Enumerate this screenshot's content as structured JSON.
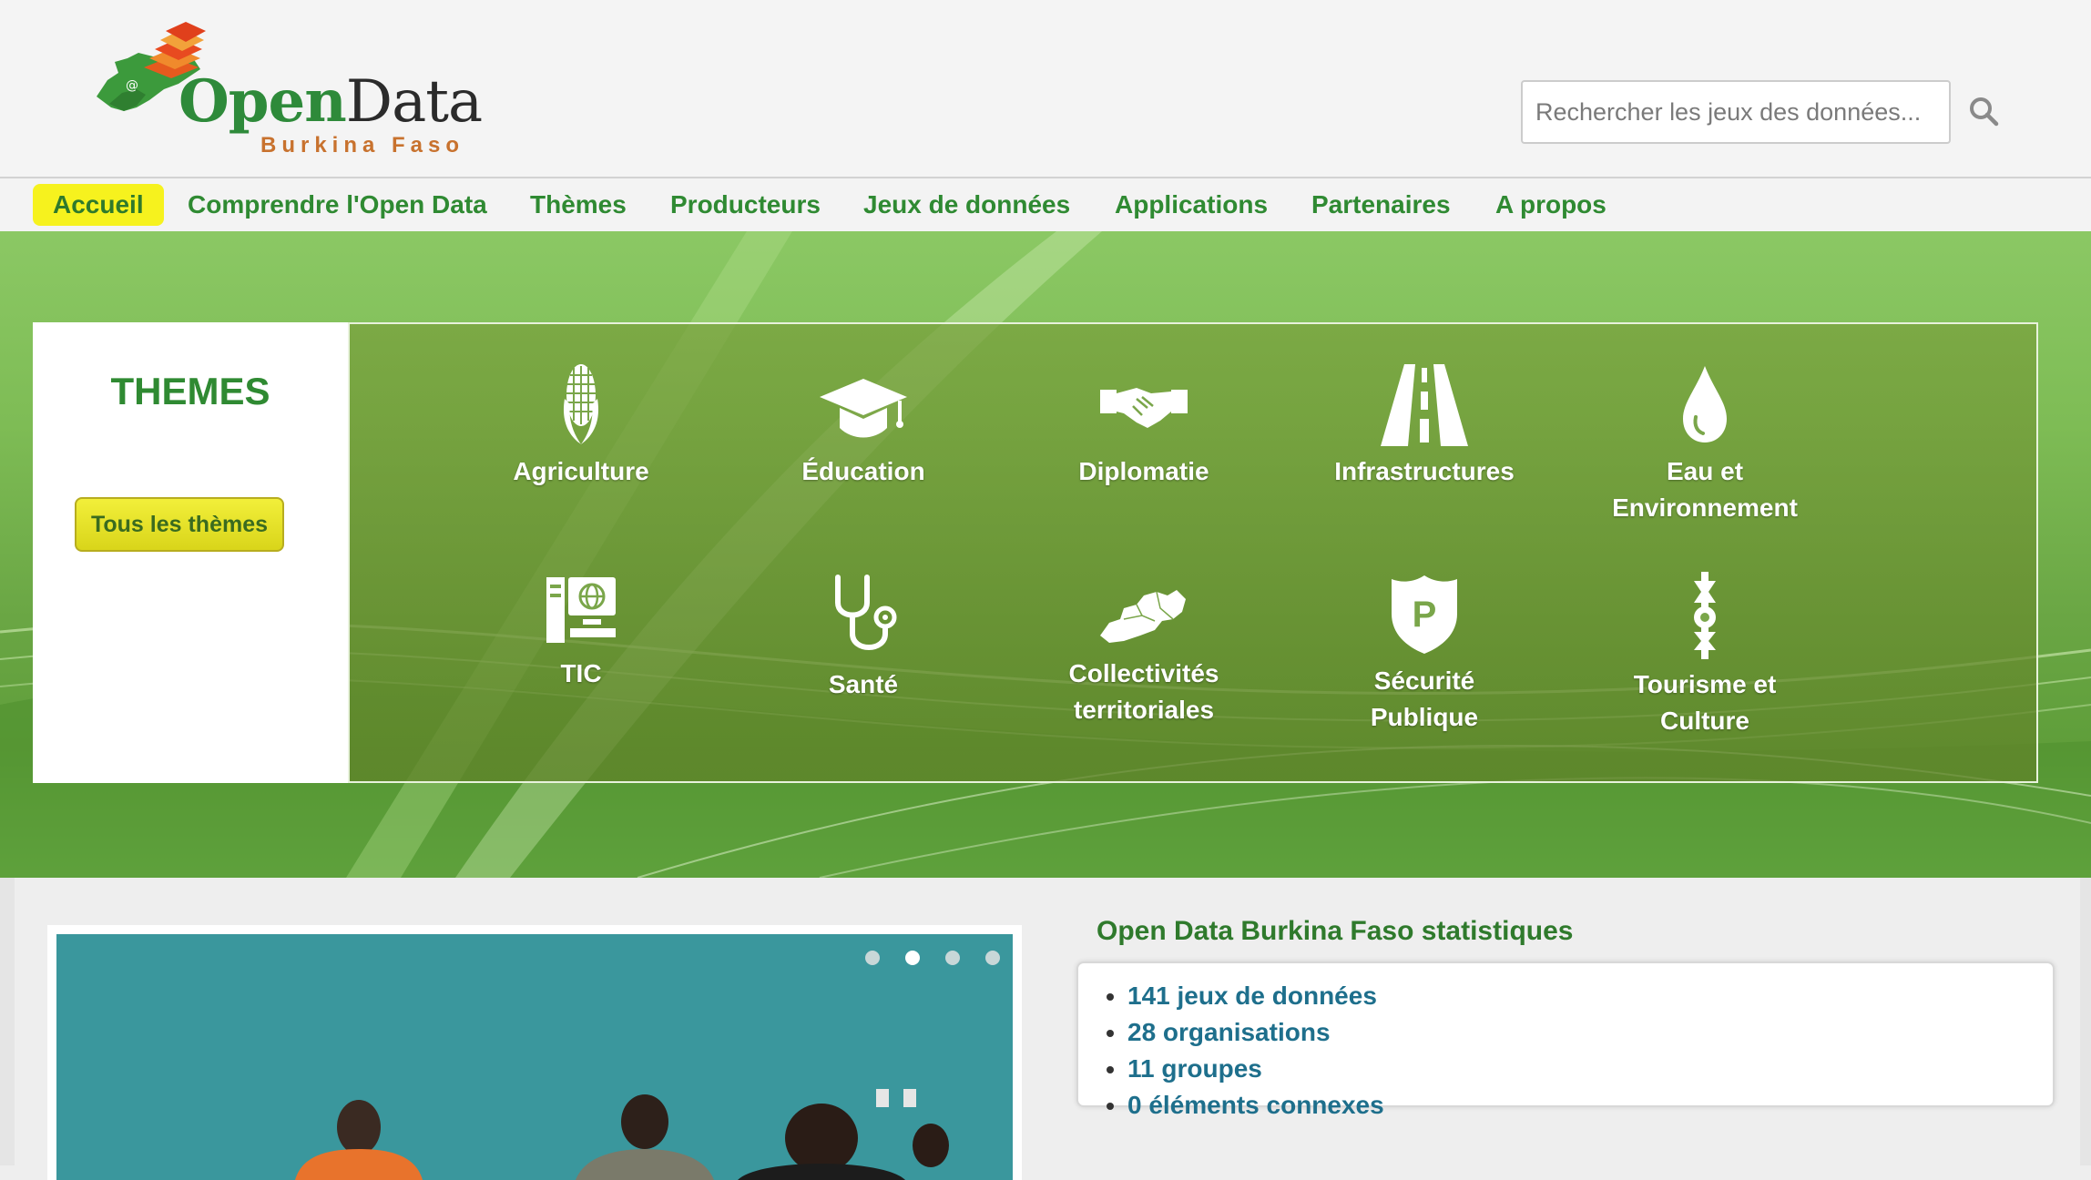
{
  "brand": {
    "name_part1": "Open",
    "name_part2": "Data",
    "subtitle": "Burkina Faso"
  },
  "search": {
    "placeholder": "Rechercher les jeux des données..."
  },
  "nav": {
    "items": [
      {
        "label": "Accueil",
        "active": true
      },
      {
        "label": "Comprendre l'Open Data"
      },
      {
        "label": "Thèmes"
      },
      {
        "label": "Producteurs"
      },
      {
        "label": "Jeux de données"
      },
      {
        "label": "Applications"
      },
      {
        "label": "Partenaires"
      },
      {
        "label": "A propos"
      }
    ]
  },
  "themes": {
    "title": "THEMES",
    "all_button": "Tous les thèmes",
    "items": [
      {
        "line1": "Agriculture",
        "line2": "",
        "icon": "corn-icon"
      },
      {
        "line1": "Éducation",
        "line2": "",
        "icon": "graduation-cap-icon"
      },
      {
        "line1": "Diplomatie",
        "line2": "",
        "icon": "handshake-icon"
      },
      {
        "line1": "Infrastructures",
        "line2": "",
        "icon": "road-icon"
      },
      {
        "line1": "Eau et",
        "line2": "Environnement",
        "icon": "water-drop-icon"
      },
      {
        "line1": "TIC",
        "line2": "",
        "icon": "computer-icon"
      },
      {
        "line1": "Santé",
        "line2": "",
        "icon": "stethoscope-icon"
      },
      {
        "line1": "Collectivités",
        "line2": "territoriales",
        "icon": "map-icon"
      },
      {
        "line1": "Sécurité",
        "line2": "Publique",
        "icon": "police-badge-icon"
      },
      {
        "line1": "Tourisme et",
        "line2": "Culture",
        "icon": "totem-icon"
      }
    ]
  },
  "stats": {
    "title": "Open Data Burkina Faso statistiques",
    "items": [
      "141 jeux de données",
      "28 organisations",
      "11 groupes",
      "0 éléments connexes"
    ]
  },
  "carousel": {
    "slide_count": 4,
    "active_index": 1
  },
  "colors": {
    "brand_green": "#2f8a32",
    "nav_active_bg": "#f6f21e",
    "stats_link": "#1e6f8c",
    "logo_orange": "#c8722e"
  }
}
